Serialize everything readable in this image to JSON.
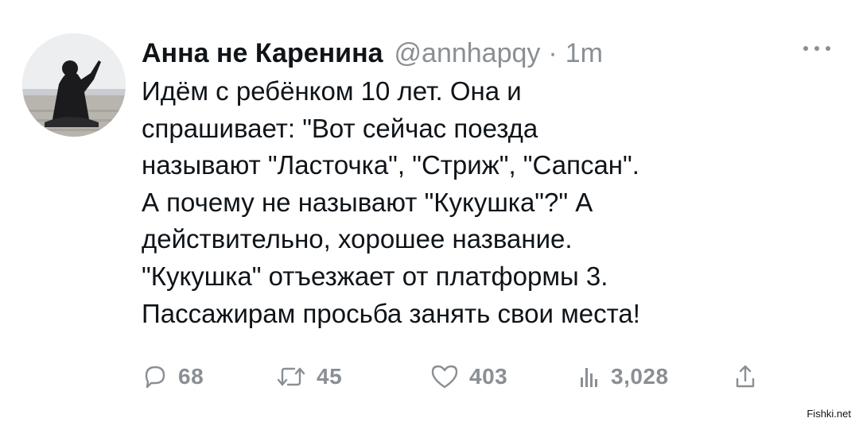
{
  "tweet": {
    "author": {
      "display_name": "Анна не Каренина",
      "handle": "@annhapqy",
      "separator": "·",
      "time": "1m",
      "avatar_icon": "avatar-photo"
    },
    "more_icon": "more-dots-icon",
    "text_lines": [
      "Идём с ребёнком 10 лет. Она и",
      "спрашивает: \"Вот сейчас поезда",
      "называют \"Ласточка\", \"Стриж\", \"Сапсан\".",
      "А почему не называют \"Кукушка\"?\" А",
      "действительно, хорошее название.",
      "\"Кукушка\" отъезжает от платформы 3.",
      "Пассажирам просьба занять свои места!"
    ],
    "actions": {
      "reply": {
        "icon": "reply-icon",
        "count": "68"
      },
      "retweet": {
        "icon": "retweet-icon",
        "count": "45"
      },
      "like": {
        "icon": "heart-icon",
        "count": "403"
      },
      "views": {
        "icon": "views-chart-icon",
        "count": "3,028"
      },
      "share": {
        "icon": "share-icon"
      }
    }
  },
  "watermark": "Fishki.net",
  "colors": {
    "text": "#0f1419",
    "muted": "#8a8f94",
    "background": "#ffffff"
  }
}
